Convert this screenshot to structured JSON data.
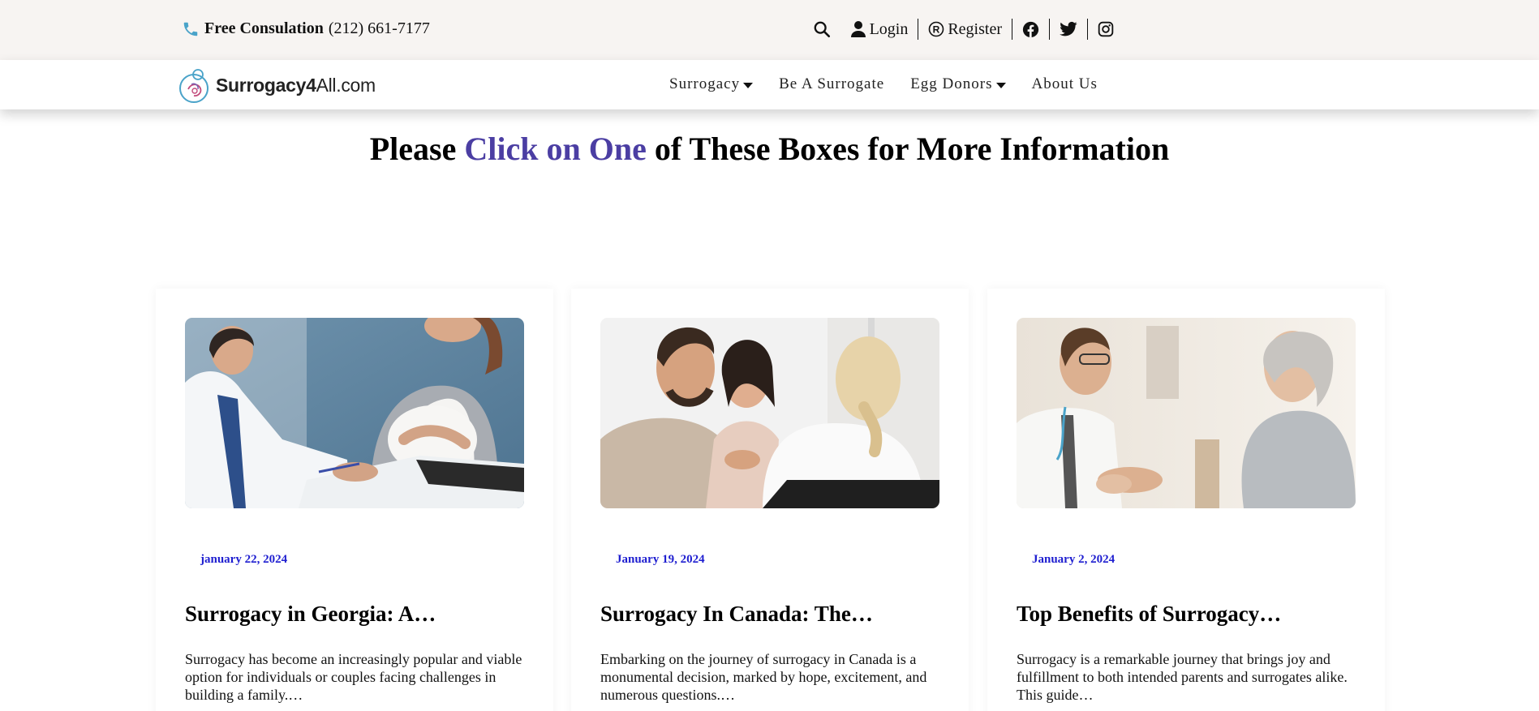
{
  "topbar": {
    "consult_label": "Free Consulation",
    "phone": "(212) 661-7177",
    "login": "Login",
    "register": "Register",
    "icons": [
      "phone-icon",
      "search-icon",
      "user-icon",
      "registered-icon",
      "facebook-icon",
      "twitter-icon",
      "instagram-icon"
    ]
  },
  "logo": {
    "bold": "Surrogacy4",
    "rest": "All.com"
  },
  "nav": {
    "items": [
      {
        "label": "Surrogacy",
        "has_dropdown": true
      },
      {
        "label": "Be A Surrogate",
        "has_dropdown": false
      },
      {
        "label": "Egg Donors",
        "has_dropdown": true
      },
      {
        "label": "About Us",
        "has_dropdown": false
      }
    ]
  },
  "heading": {
    "before": "Please ",
    "accent": "Click on One",
    "after": " of These Boxes for More Information"
  },
  "colors": {
    "accent": "#4b3ea3",
    "date": "#1e1ed0",
    "topbar_bg": "#f7f4f2",
    "phone_icon": "#4aa3c9"
  },
  "cards": [
    {
      "date": "january 22, 2024",
      "title": "Surrogacy in Georgia: A…",
      "excerpt": "Surrogacy has become an increasingly popular and viable option for individuals or couples facing challenges in building a family.…",
      "image": "doctor-with-pregnant-woman-photo"
    },
    {
      "date": "January 19, 2024",
      "title": "Surrogacy In Canada: The…",
      "excerpt": "Embarking on the journey of surrogacy in Canada is a monumental decision, marked by hope, excitement, and numerous questions.…",
      "image": "couple-consulting-doctor-photo"
    },
    {
      "date": "January 2, 2024",
      "title": "Top Benefits of Surrogacy…",
      "excerpt": "Surrogacy is a remarkable journey that brings joy and fulfillment to both intended parents and surrogates alike. This guide…",
      "image": "doctor-holding-elderly-woman-hands-photo"
    }
  ]
}
